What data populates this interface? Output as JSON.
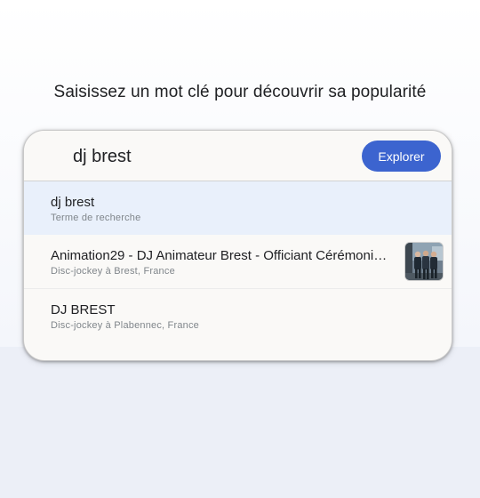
{
  "prompt": "Saisissez un mot clé pour découvrir sa popularité",
  "search": {
    "value": "dj brest",
    "explore_label": "Explorer"
  },
  "suggestions": [
    {
      "title": "dj brest",
      "subtitle": "Terme de recherche"
    },
    {
      "title": "Animation29 - DJ Animateur Brest - Officiant Cérémoni…",
      "subtitle": "Disc-jockey à Brest, France"
    },
    {
      "title": "DJ BREST",
      "subtitle": "Disc-jockey à Plabennec, France"
    }
  ],
  "colors": {
    "accent": "#3c64cf",
    "highlight": "#e9f0fb"
  }
}
